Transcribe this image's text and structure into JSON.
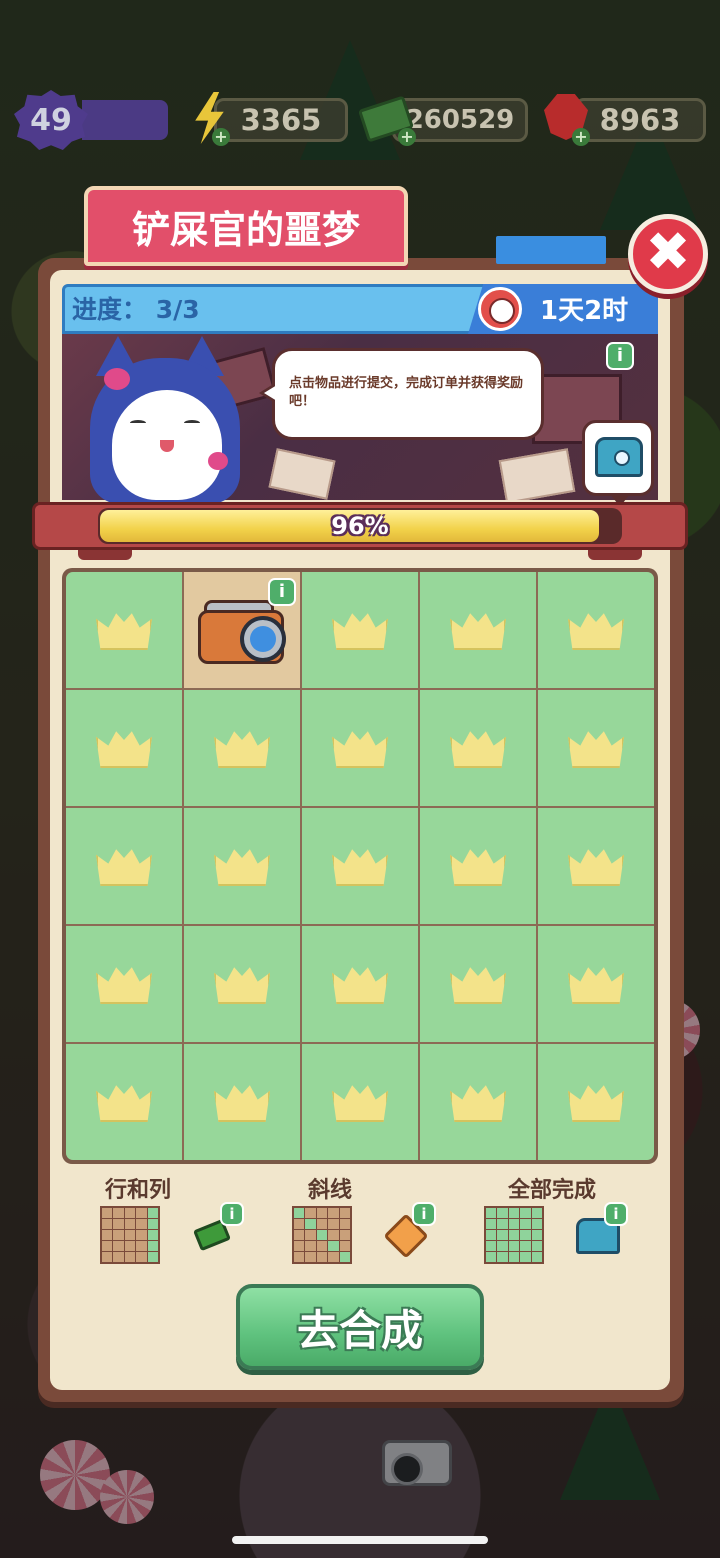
{
  "hud": {
    "level": "49",
    "energy": "3365",
    "cash": "260529",
    "gems": "8963",
    "plus": "+"
  },
  "event": {
    "title": "铲屎官的噩梦",
    "close_symbol": "✖",
    "progress_label": "进度： 3/3",
    "timer": "1天2时",
    "info_symbol": "i",
    "speech": "点击物品进行提交，完成订单并获得奖励吧！",
    "progress_percent_text": "96%",
    "progress_value": 0.96
  },
  "grid": {
    "rows": 5,
    "cols": 5,
    "filled_cell": {
      "row": 0,
      "col": 1,
      "item": "camera-icon"
    },
    "empty_icon": "crown-slot-icon"
  },
  "rewards": [
    {
      "title": "行和列",
      "icon": "cash-stack-icon",
      "pattern": "row-and-column"
    },
    {
      "title": "斜线",
      "icon": "orange-box-icon",
      "pattern": "diagonal"
    },
    {
      "title": "全部完成",
      "icon": "treasure-chest-icon",
      "pattern": "all"
    }
  ],
  "go_button": {
    "label": "去合成"
  },
  "colors": {
    "accent_pink": "#e24f6a",
    "header_blue": "#69c0ee",
    "cell_green": "#97d79a",
    "button_green": "#5fc27e",
    "progress_yellow": "#f2d24a"
  }
}
